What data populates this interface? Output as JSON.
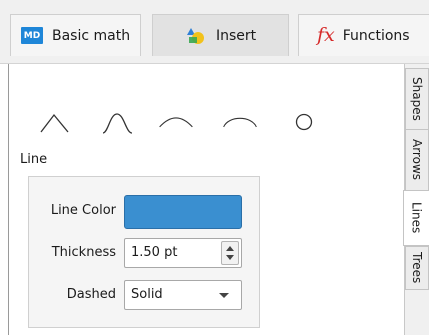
{
  "top_tabs": [
    {
      "label": "Basic math",
      "icon": "md-icon",
      "icon_text": "MD",
      "active": false
    },
    {
      "label": "Insert",
      "icon": "shapes-insert-icon",
      "active": true
    },
    {
      "label": "Functions",
      "icon": "fx-icon",
      "icon_text": "fx",
      "active": false
    }
  ],
  "shapes": [
    "caret-shape",
    "bell-arc-shape",
    "arc-shape",
    "half-arc-shape",
    "circle-shape"
  ],
  "line_section": {
    "title": "Line",
    "line_color_label": "Line Color",
    "line_color_value": "#3a8fd0",
    "thickness_label": "Thickness",
    "thickness_value": "1.50 pt",
    "dashed_label": "Dashed",
    "dashed_value": "Solid"
  },
  "side_tabs": [
    {
      "label": "Shapes",
      "active": false
    },
    {
      "label": "Arrows",
      "active": false
    },
    {
      "label": "Lines",
      "active": true
    },
    {
      "label": "Trees",
      "active": false
    }
  ]
}
